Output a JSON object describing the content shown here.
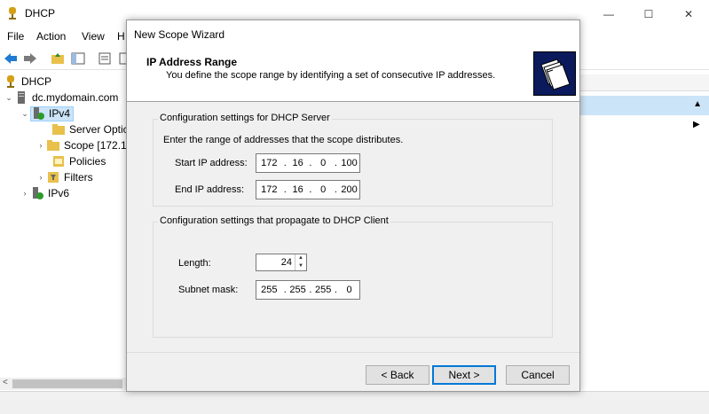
{
  "app": {
    "title": "DHCP",
    "menu": [
      "File",
      "Action",
      "View",
      "H"
    ],
    "window_buttons": [
      "—",
      "☐",
      "✕"
    ]
  },
  "tree": {
    "items": [
      {
        "label": "DHCP"
      },
      {
        "label": "dc.mydomain.com",
        "expander": "⌄"
      },
      {
        "label": "IPv4",
        "expander": "⌄"
      },
      {
        "label": "Server Optic"
      },
      {
        "label": "Scope [172.1",
        "expander": "›"
      },
      {
        "label": "Policies"
      },
      {
        "label": "Filters",
        "expander": "›"
      },
      {
        "label": "IPv6",
        "expander": "›"
      }
    ]
  },
  "wizard": {
    "window_title": "New Scope Wizard",
    "header_title": "IP Address Range",
    "header_desc": "You define the scope range by identifying a set of consecutive IP addresses.",
    "server_group": {
      "legend": "Configuration settings for DHCP Server",
      "instruction": "Enter the range of addresses that the scope distributes.",
      "start_label": "Start IP address:",
      "start_ip": [
        "172",
        "16",
        "0",
        "100"
      ],
      "end_label": "End IP address:",
      "end_ip": [
        "172",
        "16",
        "0",
        "200"
      ]
    },
    "client_group": {
      "legend": "Configuration settings that propagate to DHCP Client",
      "length_label": "Length:",
      "length_value": "24",
      "mask_label": "Subnet mask:",
      "mask": [
        "255",
        "255",
        "255",
        "0"
      ]
    },
    "buttons": {
      "back": "< Back",
      "next": "Next >",
      "cancel": "Cancel"
    }
  },
  "colors": {
    "selection": "#cce4f7",
    "default_button_border": "#0078d7",
    "header_icon_bg": "#0a1a5c"
  }
}
